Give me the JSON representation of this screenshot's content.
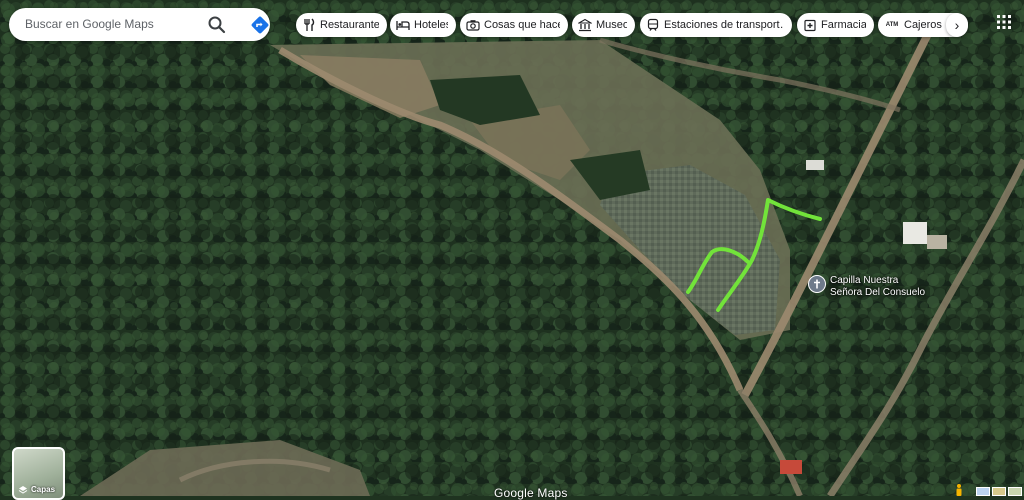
{
  "search": {
    "placeholder": "Buscar en Google Maps",
    "search_icon": "search-icon",
    "directions_icon": "directions-icon"
  },
  "categories": [
    {
      "label": "Restaurantes",
      "icon": "restaurant-icon"
    },
    {
      "label": "Hoteles",
      "icon": "hotel-icon"
    },
    {
      "label": "Cosas que hacer",
      "icon": "camera-icon"
    },
    {
      "label": "Museos",
      "icon": "museum-icon"
    },
    {
      "label": "Estaciones de transport…",
      "icon": "train-icon"
    },
    {
      "label": "Farmacias",
      "icon": "pharmacy-icon"
    },
    {
      "label": "Cajeros au",
      "icon": "atm-icon"
    }
  ],
  "more_label": "›",
  "atm_glyph": "ATM",
  "poi": {
    "name_line1": "Capilla Nuestra",
    "name_line2": "Señora Del Consuelo",
    "icon": "church-icon"
  },
  "layers": {
    "label": "Capas"
  },
  "branding": "Google Maps",
  "colors": {
    "annotation": "#72e33a",
    "poi_pin": "#6e7a8a",
    "forest_dark": "#1c2d1d",
    "dirt_road": "#9c8a6f"
  }
}
